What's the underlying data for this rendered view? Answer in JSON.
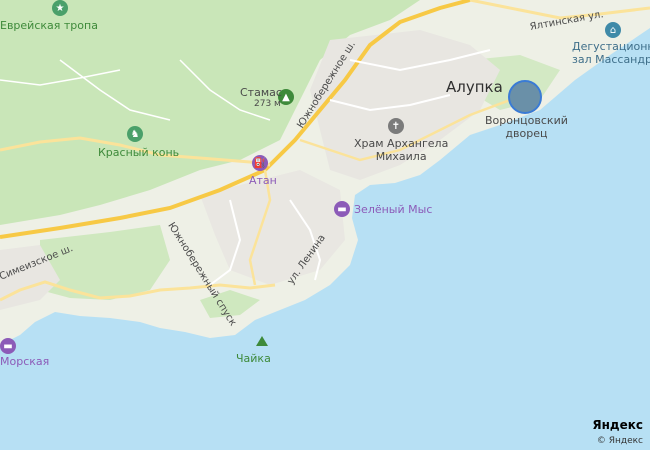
{
  "map": {
    "labels": {
      "evreiskaya": "Еврейская тропа",
      "stamas": "Стамас",
      "stamas_alt": "273 м",
      "krasny_kon": "Красный конь",
      "atan": "Атан",
      "alupka": "Алупка",
      "vorontsov": "Воронцовский\nдворец",
      "degust": "Дегустационны\nзал Массандр",
      "khram": "Храм Архангела\nМихаила",
      "zeleny_mys": "Зелёный Мыс",
      "chaika": "Чайка",
      "morskaya": "Морская"
    },
    "roads": {
      "yuzhnoberezhnoe_sh": "Южнобережное ш.",
      "yuzhnoberezhny_spusk": "Южнобережный спуск",
      "ul_lenina": "ул. Ленина",
      "simeizskoe_sh": "Симеизское ш.",
      "yaltinskaya": "Ялтинская ул."
    },
    "branding": {
      "logo": "Яндекс",
      "copyright": "© Яндекс"
    },
    "colors": {
      "sea": "#b7e0f4",
      "forest": "#c9e6b8",
      "land": "#eef0e6",
      "urban": "#e8e6e1",
      "road_major": "#f7c945",
      "road_minor": "#fbe39a"
    },
    "icons": {
      "evreiskaya": "star-icon",
      "stamas": "mountain-icon",
      "krasny_kon": "horse-icon",
      "atan": "fuel-icon",
      "khram": "church-icon",
      "zeleny_mys": "hotel-icon",
      "degust": "museum-icon",
      "chaika": "mountain-icon",
      "morskaya": "hotel-icon"
    }
  }
}
